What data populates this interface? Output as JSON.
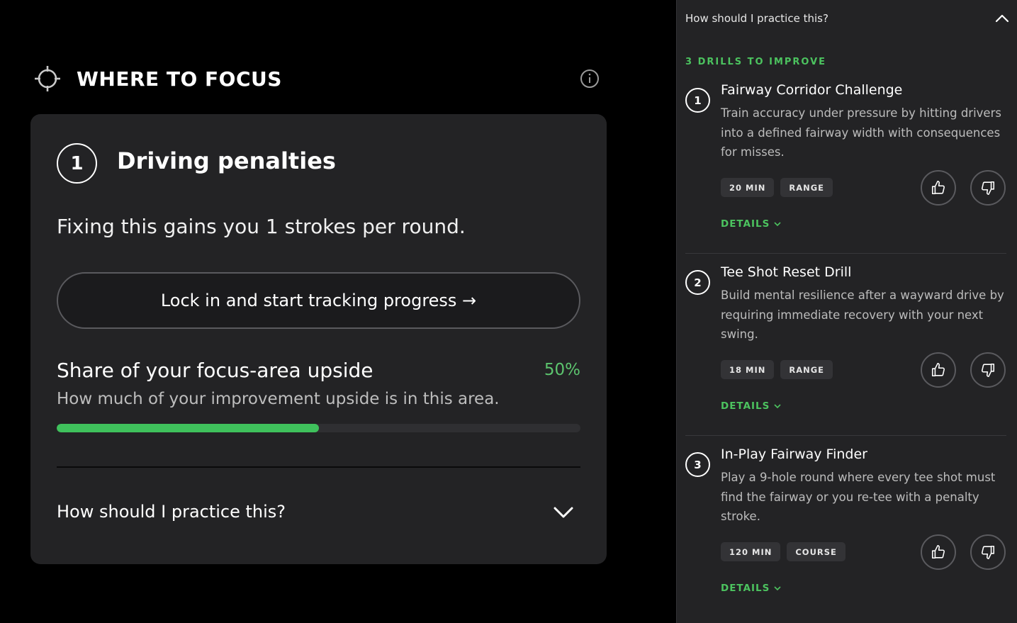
{
  "focus": {
    "title": "WHERE TO FOCUS"
  },
  "card": {
    "rank": "1",
    "title": "Driving penalties",
    "gain_text": "Fixing this gains you 1 strokes per round.",
    "cta_label": "Lock in and start tracking progress →",
    "share_title": "Share of your focus-area upside",
    "share_percent_label": "50%",
    "share_fraction": 0.5,
    "share_description": "How much of your improvement upside is in this area.",
    "practice_label": "How should I practice this?"
  },
  "panel": {
    "header": "How should I practice this?",
    "drills_title": "3 DRILLS TO IMPROVE",
    "drills": [
      {
        "num": "1",
        "title": "Fairway Corridor Challenge",
        "description": "Train accuracy under pressure by hitting drivers into a defined fairway width with consequences for misses.",
        "duration": "20 MIN",
        "location": "RANGE",
        "details": "DETAILS"
      },
      {
        "num": "2",
        "title": "Tee Shot Reset Drill",
        "description": "Build mental resilience after a wayward drive by requiring immediate recovery with your next swing.",
        "duration": "18 MIN",
        "location": "RANGE",
        "details": "DETAILS"
      },
      {
        "num": "3",
        "title": "In-Play Fairway Finder",
        "description": "Play a 9-hole round where every tee shot must find the fairway or you re-tee with a penalty stroke.",
        "duration": "120 MIN",
        "location": "COURSE",
        "details": "DETAILS"
      }
    ]
  },
  "colors": {
    "accent_green": "#4cc35f",
    "progress_green": "#3fc15c",
    "card_bg": "#232325",
    "page_bg": "#000000"
  },
  "icons": {
    "focus": "crosshair-icon",
    "info": "info-icon",
    "expand": "chevron-down-icon",
    "collapse": "chevron-up-icon",
    "upvote": "thumbs-up-icon",
    "downvote": "thumbs-down-icon"
  }
}
